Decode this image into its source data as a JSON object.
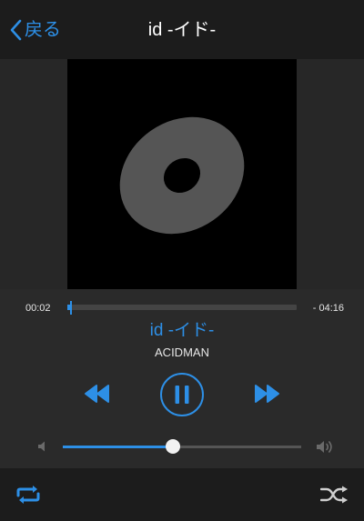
{
  "header": {
    "back_label": "戻る",
    "title": "id -イド-"
  },
  "artwork": {
    "icon": "disc-icon"
  },
  "progress": {
    "elapsed": "00:02",
    "remaining": "- 04:16",
    "position_fraction": 0.01
  },
  "track": {
    "title": "id -イド-",
    "artist": "ACIDMAN"
  },
  "controls": {
    "rewind_icon": "rewind-icon",
    "pause_icon": "pause-icon",
    "forward_icon": "fast-forward-icon",
    "repeat_icon": "repeat-icon",
    "shuffle_icon": "shuffle-icon"
  },
  "volume": {
    "level_fraction": 0.46
  },
  "colors": {
    "accent": "#2d8fe6",
    "background": "#272727",
    "bar": "#1c1c1c",
    "artwork_background": "#000000",
    "disc": "#555555"
  }
}
